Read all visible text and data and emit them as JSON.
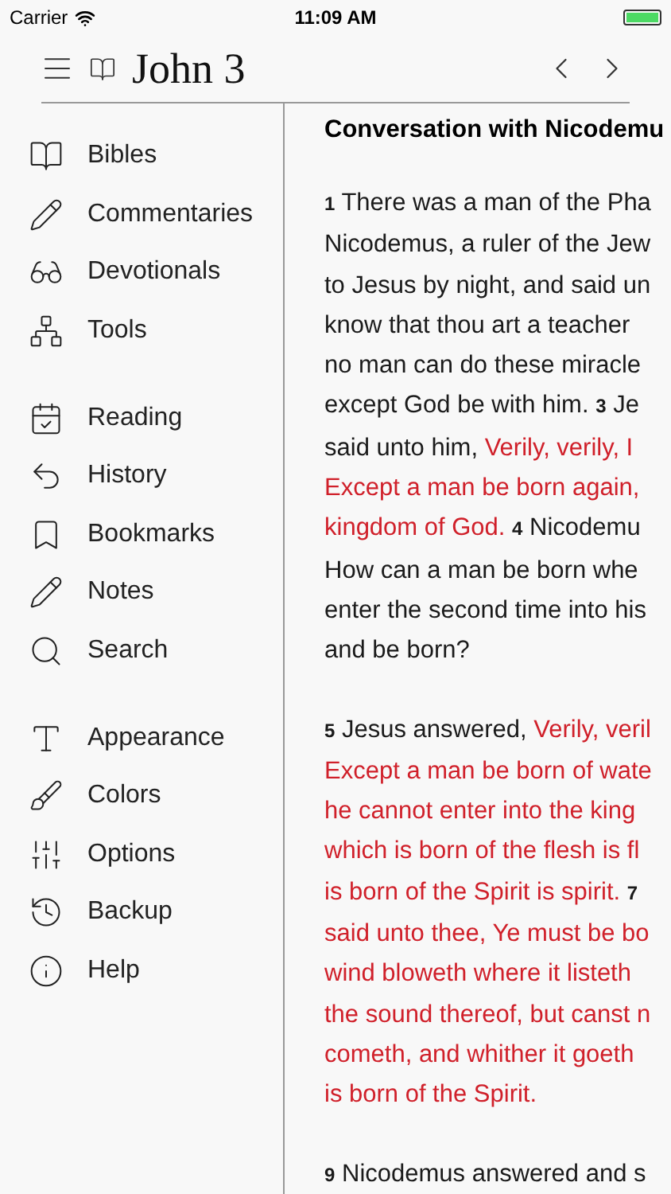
{
  "status_bar": {
    "carrier": "Carrier",
    "time": "11:09 AM"
  },
  "header": {
    "title": "John 3"
  },
  "sidebar": {
    "groups": [
      {
        "items": [
          {
            "label": "Bibles"
          },
          {
            "label": "Commentaries"
          },
          {
            "label": "Devotionals"
          },
          {
            "label": "Tools"
          }
        ]
      },
      {
        "items": [
          {
            "label": "Reading"
          },
          {
            "label": "History"
          },
          {
            "label": "Bookmarks"
          },
          {
            "label": "Notes"
          },
          {
            "label": "Search"
          }
        ]
      },
      {
        "items": [
          {
            "label": "Appearance"
          },
          {
            "label": "Colors"
          },
          {
            "label": "Options"
          },
          {
            "label": "Backup"
          },
          {
            "label": "Help"
          }
        ]
      }
    ]
  },
  "reader": {
    "heading": "Conversation with Nicodemu",
    "paragraphs": [
      {
        "lines": [
          [
            {
              "kind": "num",
              "text": "1"
            },
            {
              "kind": "plain",
              "text": " There was a man of the Pha"
            }
          ],
          [
            {
              "kind": "plain",
              "text": "Nicodemus, a ruler of the Jew"
            }
          ],
          [
            {
              "kind": "plain",
              "text": "to Jesus by night, and said un"
            }
          ],
          [
            {
              "kind": "plain",
              "text": "know that thou art a teacher"
            }
          ],
          [
            {
              "kind": "plain",
              "text": "no man can do these miracle"
            }
          ],
          [
            {
              "kind": "plain",
              "text": "except God be with him. "
            },
            {
              "kind": "num",
              "text": "3"
            },
            {
              "kind": "plain",
              "text": " Je"
            }
          ],
          [
            {
              "kind": "plain",
              "text": "said unto him, "
            },
            {
              "kind": "red",
              "text": "Verily, verily, I"
            }
          ],
          [
            {
              "kind": "red",
              "text": "Except a man be born again,"
            }
          ],
          [
            {
              "kind": "red",
              "text": "kingdom of God. "
            },
            {
              "kind": "num",
              "text": "4"
            },
            {
              "kind": "plain",
              "text": " Nicodemu"
            }
          ],
          [
            {
              "kind": "plain",
              "text": "How can a man be born whe"
            }
          ],
          [
            {
              "kind": "plain",
              "text": "enter the second time into his"
            }
          ],
          [
            {
              "kind": "plain",
              "text": "and be born?"
            }
          ]
        ]
      },
      {
        "lines": [
          [
            {
              "kind": "num",
              "text": "5"
            },
            {
              "kind": "plain",
              "text": " Jesus answered, "
            },
            {
              "kind": "red",
              "text": "Verily, veril"
            }
          ],
          [
            {
              "kind": "red",
              "text": "Except a man be born of wate"
            }
          ],
          [
            {
              "kind": "red",
              "text": "he cannot enter into the king"
            }
          ],
          [
            {
              "kind": "red",
              "text": "which is born of the flesh is fl"
            }
          ],
          [
            {
              "kind": "red",
              "text": "is born of the Spirit is spirit. "
            },
            {
              "kind": "num",
              "text": "7"
            }
          ],
          [
            {
              "kind": "red",
              "text": "said unto thee, Ye must be bo"
            }
          ],
          [
            {
              "kind": "red",
              "text": "wind bloweth where it listeth"
            }
          ],
          [
            {
              "kind": "red",
              "text": "the sound thereof, but canst n"
            }
          ],
          [
            {
              "kind": "red",
              "text": "cometh, and whither it goeth"
            }
          ],
          [
            {
              "kind": "red",
              "text": "is born of the Spirit."
            }
          ]
        ]
      },
      {
        "lines": [
          [
            {
              "kind": "num",
              "text": "9"
            },
            {
              "kind": "plain",
              "text": " Nicodemus answered and s"
            }
          ]
        ]
      }
    ]
  }
}
